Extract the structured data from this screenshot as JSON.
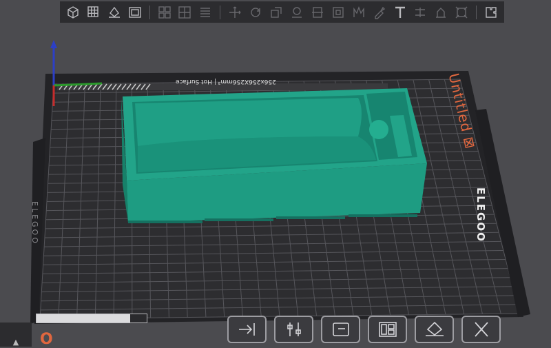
{
  "toolbar": {
    "items": [
      {
        "icon": "add-cube-icon"
      },
      {
        "icon": "grid-add-icon"
      },
      {
        "icon": "orient-icon"
      },
      {
        "icon": "plate-icon"
      },
      {
        "icon": "arrange-icon"
      },
      {
        "icon": "arrange-grid-icon"
      },
      {
        "icon": "layers-icon"
      },
      {
        "icon": "move-icon"
      },
      {
        "icon": "rotate-icon"
      },
      {
        "icon": "scale-icon"
      },
      {
        "icon": "place-face-icon"
      },
      {
        "icon": "cut-icon"
      },
      {
        "icon": "mesh-boolean-icon"
      },
      {
        "icon": "support-paint-icon"
      },
      {
        "icon": "seam-paint-icon"
      },
      {
        "icon": "text-icon"
      },
      {
        "icon": "measure-icon"
      },
      {
        "icon": "assembly-icon"
      },
      {
        "icon": "variable-layer-icon"
      },
      {
        "icon": "puzzle-icon"
      }
    ]
  },
  "plate": {
    "name": "Untitled",
    "spec": "256x256X256mm³ | Hot Surface",
    "brand_right": "ELEGOO",
    "brand_left": "ELEGOO"
  },
  "progress": {
    "fraction": 0.85
  },
  "bottom_actions": [
    {
      "icon": "import-icon"
    },
    {
      "icon": "settings-sliders-icon"
    },
    {
      "icon": "object-list-icon"
    },
    {
      "icon": "plate-layout-icon"
    },
    {
      "icon": "auto-orient-icon"
    },
    {
      "icon": "delete-icon"
    }
  ],
  "colors": {
    "model": "#1e9c82",
    "model_dark": "#17806a",
    "bed": "#2d2d30",
    "grid": "#56565b",
    "accent": "#e0673f"
  }
}
